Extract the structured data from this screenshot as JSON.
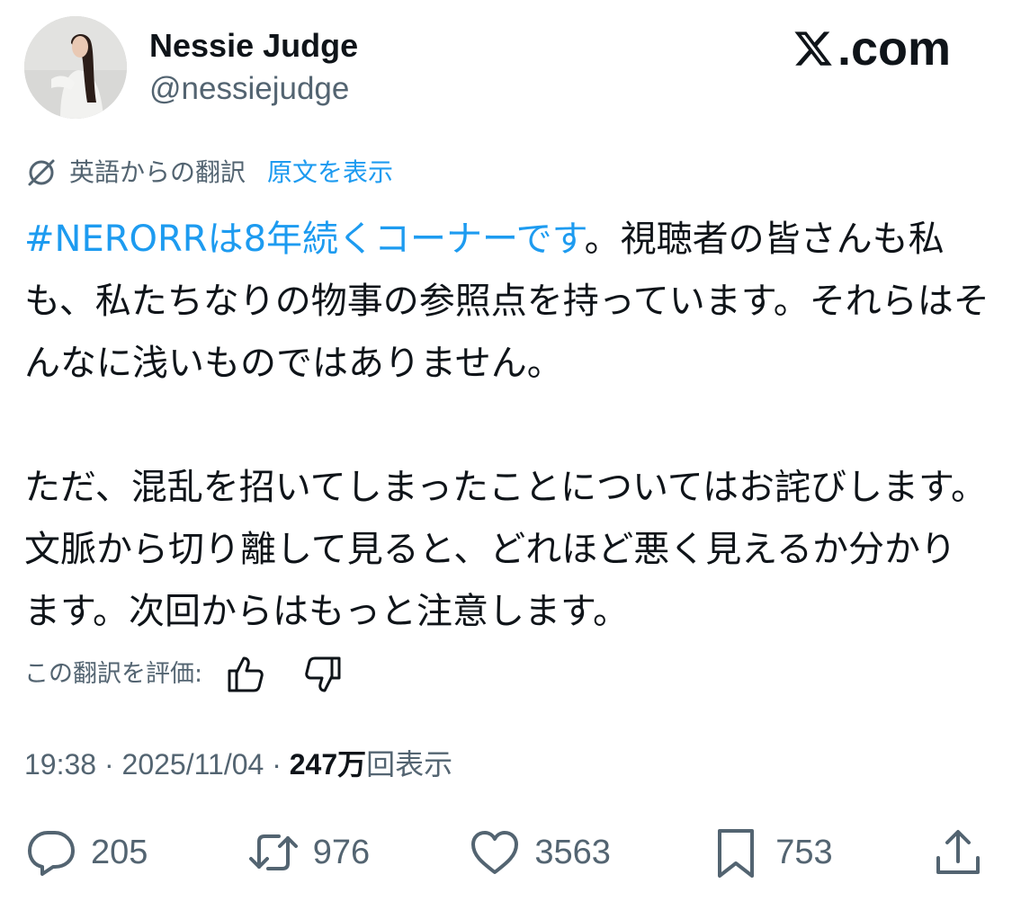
{
  "author": {
    "display_name": "Nessie Judge",
    "handle": "@nessiejudge"
  },
  "brand": {
    "logo_icon": "x-logo-icon",
    "suffix": ".com"
  },
  "translation": {
    "icon": "translate-icon",
    "label": "英語からの翻訳",
    "show_original": "原文を表示"
  },
  "tweet": {
    "hashtag": "#NERORRは8年続くコーナーです",
    "text": "。視聴者の皆さんも私も、私たちなりの物事の参照点を持っています。それらはそんなに浅いものではありません。\n\nただ、混乱を招いてしまったことについてはお詫びします。文脈から切り離して見ると、どれほど悪く見えるか分かります。次回からはもっと注意します。"
  },
  "rating": {
    "label": "この翻訳を評価:",
    "thumbs_up_icon": "thumbs-up-icon",
    "thumbs_down_icon": "thumbs-down-icon"
  },
  "meta": {
    "time": "19:38",
    "separator": " · ",
    "date": "2025/11/04",
    "views_count": "247万",
    "views_label": "回表示"
  },
  "actions": {
    "replies": "205",
    "reposts": "976",
    "likes": "3563",
    "bookmarks": "753"
  },
  "colors": {
    "text": "#0f1419",
    "secondary": "#536471",
    "link": "#1d9bf0"
  }
}
